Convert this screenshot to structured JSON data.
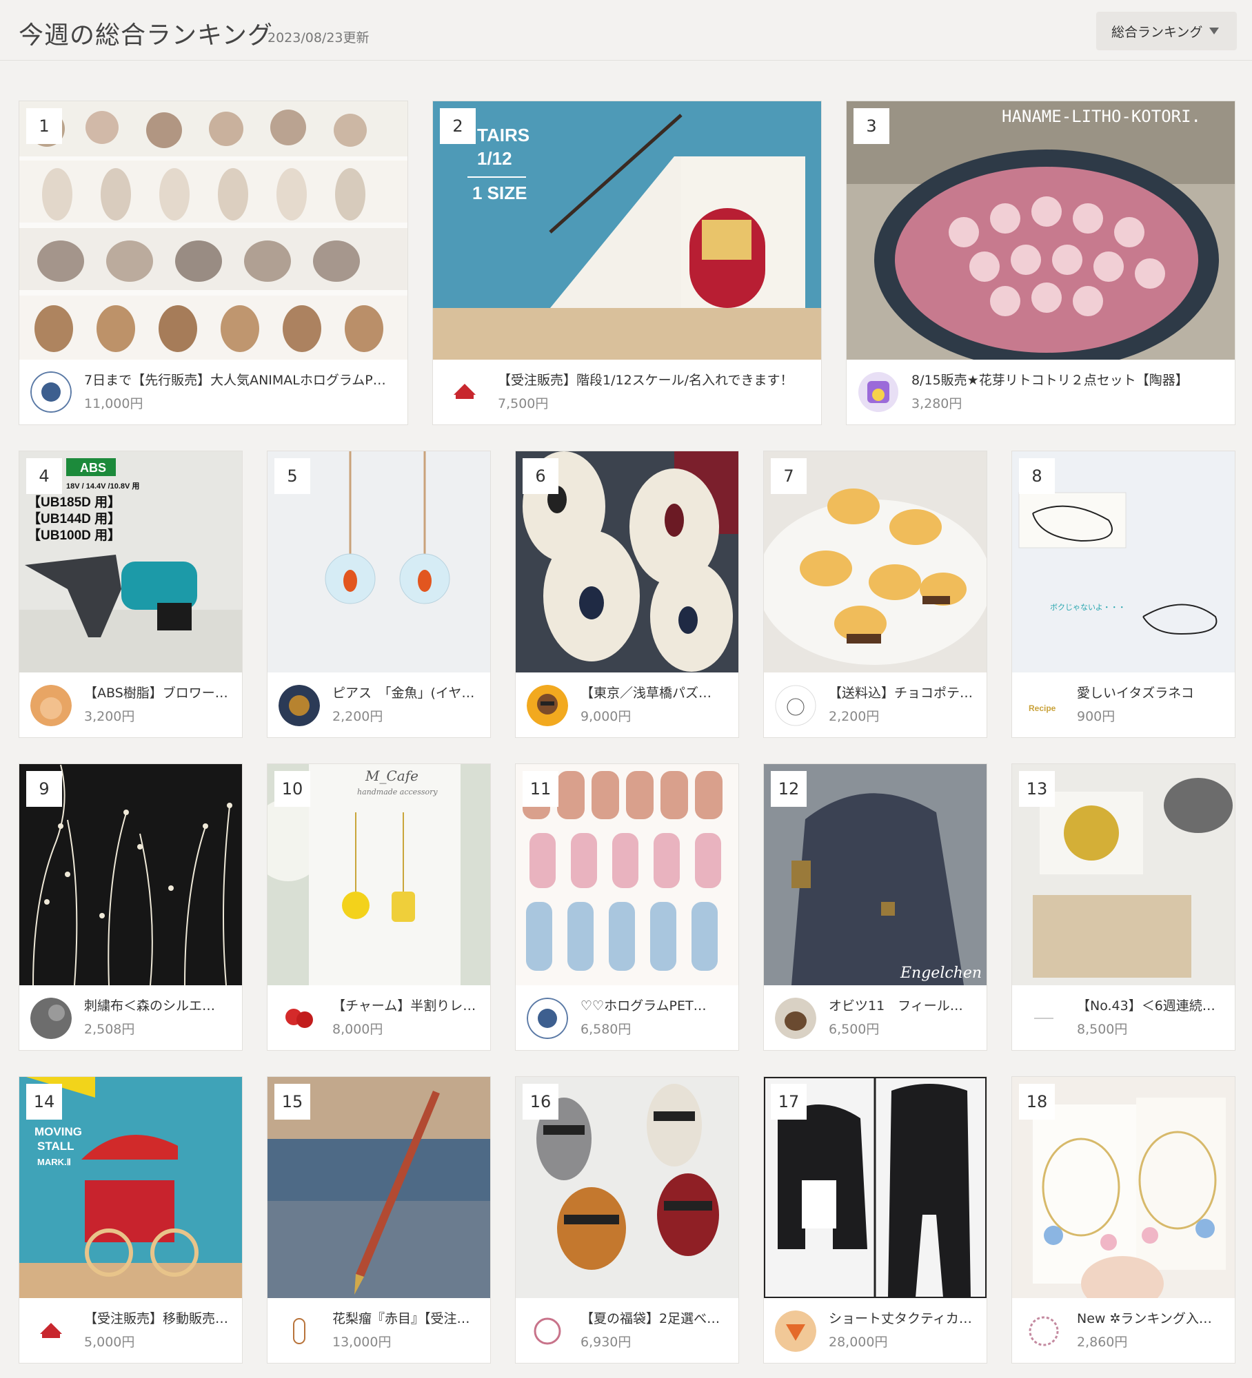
{
  "header": {
    "title": "今週の総合ランキング",
    "updated": "2023/08/23更新",
    "select_value": "総合ランキング"
  },
  "items": [
    {
      "rank": "1",
      "name": "7日まで【先行販売】大人気ANIMALホログラムP…",
      "price": "11,000円",
      "image": "animal-stickers"
    },
    {
      "rank": "2",
      "name": "【受注販売】階段1/12スケール/名入れできます！",
      "price": "7,500円",
      "image": "miniature-stairs"
    },
    {
      "rank": "3",
      "name": "8/15販売★花芽リトコトリ２点セット【陶器】",
      "price": "3,280円",
      "image": "pottery-bowl"
    },
    {
      "rank": "4",
      "name": "【ABS樹脂】ブロワー…",
      "price": "3,200円",
      "image": "blower-nozzle"
    },
    {
      "rank": "5",
      "name": "ピアス　「金魚」(イヤ…",
      "price": "2,200円",
      "image": "goldfish-earrings"
    },
    {
      "rank": "6",
      "name": "【東京／浅草橋パズ…",
      "price": "9,000円",
      "image": "leather-masks"
    },
    {
      "rank": "7",
      "name": "【送料込】チョコポテ…",
      "price": "2,200円",
      "image": "chip-charms"
    },
    {
      "rank": "8",
      "name": "愛しいイタズラネコ",
      "price": "900円",
      "image": "cat-stamp"
    },
    {
      "rank": "9",
      "name": "刺繍布＜森のシルエ…",
      "price": "2,508円",
      "image": "embroidery-fabric"
    },
    {
      "rank": "10",
      "name": "【チャーム】半割りレ…",
      "price": "8,000円",
      "image": "lemon-charm"
    },
    {
      "rank": "11",
      "name": "♡♡ホログラムPET…",
      "price": "6,580円",
      "image": "girl-stickers"
    },
    {
      "rank": "12",
      "name": "オビツ11　フィール…",
      "price": "6,500円",
      "image": "doll-jacket"
    },
    {
      "rank": "13",
      "name": "【No.43】＜6週連続…",
      "price": "8,500円",
      "image": "wax-seal"
    },
    {
      "rank": "14",
      "name": "【受注販売】移動販売…",
      "price": "5,000円",
      "image": "moving-stall"
    },
    {
      "rank": "15",
      "name": "花梨瘤『赤目』【受注…",
      "price": "13,000円",
      "image": "wood-pen"
    },
    {
      "rank": "16",
      "name": "【夏の福袋】2足選べ…",
      "price": "6,930円",
      "image": "sandals"
    },
    {
      "rank": "17",
      "name": "ショート丈タクティカ…",
      "price": "28,000円",
      "image": "tactical-jacket"
    },
    {
      "rank": "18",
      "name": "New ✲ランキング入…",
      "price": "2,860円",
      "image": "butterfly-earrings"
    }
  ],
  "image_texts": {
    "stairs_line1": "TAIRS",
    "stairs_line2": "1/12",
    "stairs_line3": "1 SIZE",
    "pottery_watermark": "HANAME-LITHO-KOTORI.",
    "blower_badge": "ABS",
    "blower_spec": "18V / 14.4V /10.8V 用",
    "blower_models": [
      "【UB185D 用】",
      "【UB144D 用】",
      "【UB100D 用】"
    ],
    "cat_stamp_caption": "ボクじゃないよ・・・",
    "mcafe_title": "M_Cafe",
    "mcafe_sub": "handmade accessory",
    "doll_signature": "Engelchen",
    "stall_line1": "MOVING",
    "stall_line2": "STALL",
    "stall_line3": "MARK.Ⅱ"
  }
}
